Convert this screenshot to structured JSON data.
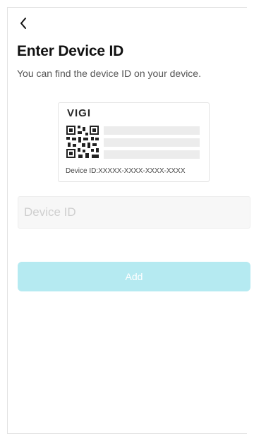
{
  "header": {
    "back_icon": "chevron-left-icon"
  },
  "page": {
    "title": "Enter Device ID",
    "subtitle": "You can find the device ID on your device."
  },
  "device_card": {
    "brand": "VIGI",
    "qr_icon": "qr-code-icon",
    "device_id_label": "Device ID:XXXXX-XXXX-XXXX-XXXX"
  },
  "form": {
    "device_id_value": "",
    "device_id_placeholder": "Device ID",
    "add_label": "Add"
  },
  "colors": {
    "accent_disabled": "#b5eaf1",
    "title": "#111111",
    "subtitle": "#555555"
  }
}
